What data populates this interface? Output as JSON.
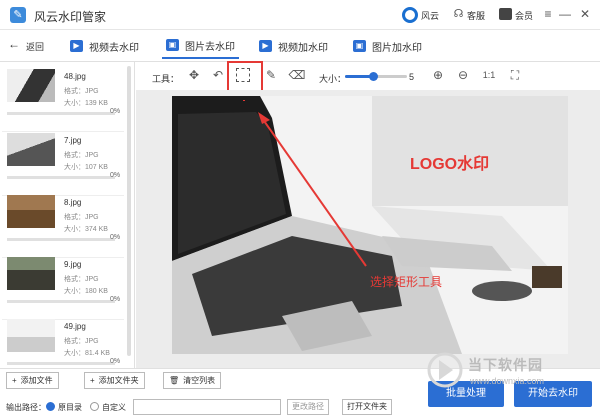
{
  "window": {
    "title": "风云水印管家",
    "brand_text": "风云",
    "service_text": "客服",
    "vip_text": "会员",
    "minimize": "—",
    "maximize": "☐",
    "close": "✕"
  },
  "nav": {
    "back_label": "返回",
    "tabs": [
      {
        "label": "视频去水印",
        "active": false
      },
      {
        "label": "图片去水印",
        "active": true
      },
      {
        "label": "视频加水印",
        "active": false
      },
      {
        "label": "图片加水印",
        "active": false
      }
    ]
  },
  "files": [
    {
      "name": "48.jpg",
      "format": "格式：JPG",
      "size": "大小：139 KB",
      "progress": "0%"
    },
    {
      "name": "7.jpg",
      "format": "格式：JPG",
      "size": "大小：107 KB",
      "progress": "0%"
    },
    {
      "name": "8.jpg",
      "format": "格式：JPG",
      "size": "大小：374 KB",
      "progress": "0%"
    },
    {
      "name": "9.jpg",
      "format": "格式：JPG",
      "size": "大小：180 KB",
      "progress": "0%"
    },
    {
      "name": "49.jpg",
      "format": "格式：JPG",
      "size": "大小：81.4 KB",
      "progress": "0%"
    }
  ],
  "toolbar": {
    "label": "工具：",
    "size_label": "大小：",
    "size_value": "5",
    "size_fraction": 0.45
  },
  "annotations": {
    "logo_watermark": "LOGO水印",
    "select_rect_tool": "选择矩形工具"
  },
  "bottom": {
    "add_file": "添加文件",
    "add_folder": "添加文件夹",
    "clear_list": "清空列表",
    "output_label": "输出路径：",
    "radio_original": "原目录",
    "radio_custom": "自定义",
    "change_path": "更改路径",
    "open_folder": "打开文件夹",
    "batch_process": "批量处理",
    "start_remove": "开始去水印"
  },
  "watermark": {
    "name": "当下软件园",
    "url": "www.downxia.com"
  },
  "colors": {
    "accent": "#2b6ed3",
    "highlight": "#e53935"
  }
}
